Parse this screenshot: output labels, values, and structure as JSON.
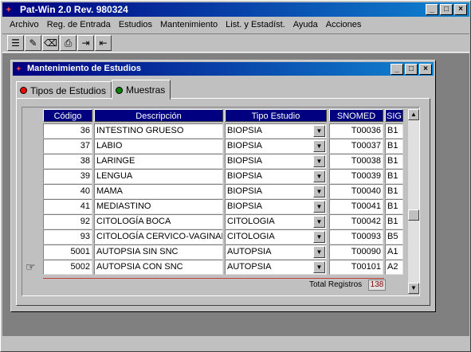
{
  "app": {
    "title": "Pat-Win 2.0 Rev. 980324"
  },
  "menu": [
    "Archivo",
    "Reg. de Entrada",
    "Estudios",
    "Mantenimiento",
    "List. y Estadíst.",
    "Ayuda",
    "Acciones"
  ],
  "window": {
    "title": "Mantenimiento de Estudios"
  },
  "tabs": [
    {
      "label": "Tipos de Estudios",
      "color": "#ff0000"
    },
    {
      "label": "Muestras",
      "color": "#008000"
    }
  ],
  "grid": {
    "headers": [
      "Código",
      "Descripción",
      "Tipo Estudio",
      "SNOMED",
      "SIG"
    ],
    "rows": [
      {
        "codigo": "36",
        "descripcion": "INTESTINO GRUESO",
        "tipo": "BIOPSIA",
        "snomed": "T00036",
        "sig": "B1"
      },
      {
        "codigo": "37",
        "descripcion": "LABIO",
        "tipo": "BIOPSIA",
        "snomed": "T00037",
        "sig": "B1"
      },
      {
        "codigo": "38",
        "descripcion": "LARINGE",
        "tipo": "BIOPSIA",
        "snomed": "T00038",
        "sig": "B1"
      },
      {
        "codigo": "39",
        "descripcion": "LENGUA",
        "tipo": "BIOPSIA",
        "snomed": "T00039",
        "sig": "B1"
      },
      {
        "codigo": "40",
        "descripcion": "MAMA",
        "tipo": "BIOPSIA",
        "snomed": "T00040",
        "sig": "B1"
      },
      {
        "codigo": "41",
        "descripcion": "MEDIASTINO",
        "tipo": "BIOPSIA",
        "snomed": "T00041",
        "sig": "B1"
      },
      {
        "codigo": "92",
        "descripcion": "CITOLOGÍA BOCA",
        "tipo": "CITOLOGIA",
        "snomed": "T00042",
        "sig": "B1"
      },
      {
        "codigo": "93",
        "descripcion": "CITOLOGÍA CERVICO-VAGINAL",
        "tipo": "CITOLOGIA",
        "snomed": "T00093",
        "sig": "B5"
      },
      {
        "codigo": "5001",
        "descripcion": "AUTOPSIA SIN SNC",
        "tipo": "AUTOPSIA",
        "snomed": "T00090",
        "sig": "A1"
      },
      {
        "codigo": "5002",
        "descripcion": "AUTOPSIA CON SNC",
        "tipo": "AUTOPSIA",
        "snomed": "T00101",
        "sig": "A2"
      }
    ]
  },
  "footer": {
    "total_label": "Total Registros",
    "total_value": "138"
  }
}
